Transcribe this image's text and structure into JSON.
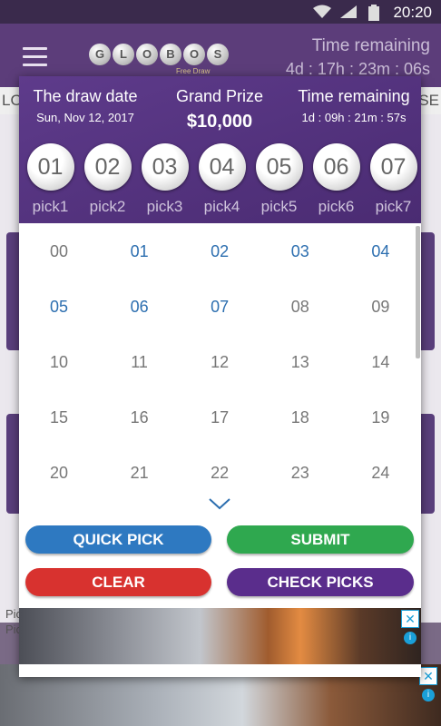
{
  "status": {
    "time": "20:20"
  },
  "app": {
    "logo_letters": [
      "G",
      "L",
      "O",
      "B",
      "O",
      "S"
    ],
    "logo_sub": "Free Draw",
    "time_label": "Time remaining",
    "time_value": "4d : 17h : 23m : 06s",
    "bg_tab_left": "LO",
    "bg_tab_right": "SE",
    "bg_pick_1": "Pic",
    "bg_pick_2": "Pic"
  },
  "dialog": {
    "draw_label": "The draw date",
    "draw_date": "Sun, Nov 12, 2017",
    "prize_label": "Grand Prize",
    "prize_value": "$10,000",
    "time_label": "Time remaining",
    "time_value": "1d : 09h : 21m : 57s",
    "picks": [
      {
        "value": "01",
        "label": "pick1"
      },
      {
        "value": "02",
        "label": "pick2"
      },
      {
        "value": "03",
        "label": "pick3"
      },
      {
        "value": "04",
        "label": "pick4"
      },
      {
        "value": "05",
        "label": "pick5"
      },
      {
        "value": "06",
        "label": "pick6"
      },
      {
        "value": "07",
        "label": "pick7"
      }
    ],
    "numbers": [
      {
        "label": "00",
        "selected": false
      },
      {
        "label": "01",
        "selected": true
      },
      {
        "label": "02",
        "selected": true
      },
      {
        "label": "03",
        "selected": true
      },
      {
        "label": "04",
        "selected": true
      },
      {
        "label": "05",
        "selected": true
      },
      {
        "label": "06",
        "selected": true
      },
      {
        "label": "07",
        "selected": true
      },
      {
        "label": "08",
        "selected": false
      },
      {
        "label": "09",
        "selected": false
      },
      {
        "label": "10",
        "selected": false
      },
      {
        "label": "11",
        "selected": false
      },
      {
        "label": "12",
        "selected": false
      },
      {
        "label": "13",
        "selected": false
      },
      {
        "label": "14",
        "selected": false
      },
      {
        "label": "15",
        "selected": false
      },
      {
        "label": "16",
        "selected": false
      },
      {
        "label": "17",
        "selected": false
      },
      {
        "label": "18",
        "selected": false
      },
      {
        "label": "19",
        "selected": false
      },
      {
        "label": "20",
        "selected": false
      },
      {
        "label": "21",
        "selected": false
      },
      {
        "label": "22",
        "selected": false
      },
      {
        "label": "23",
        "selected": false
      },
      {
        "label": "24",
        "selected": false
      }
    ],
    "buttons": {
      "quick_pick": "QUICK PICK",
      "submit": "SUBMIT",
      "clear": "CLEAR",
      "check_picks": "CHECK PICKS"
    },
    "ad": {
      "close": "✕",
      "info": "i"
    }
  },
  "colors": {
    "purple": "#5e3b8b",
    "quick_pick": "#2e79c1",
    "submit": "#2fa84f",
    "clear": "#d8322f",
    "check_picks": "#5a2d8c",
    "selected_number": "#2d6fb0"
  }
}
